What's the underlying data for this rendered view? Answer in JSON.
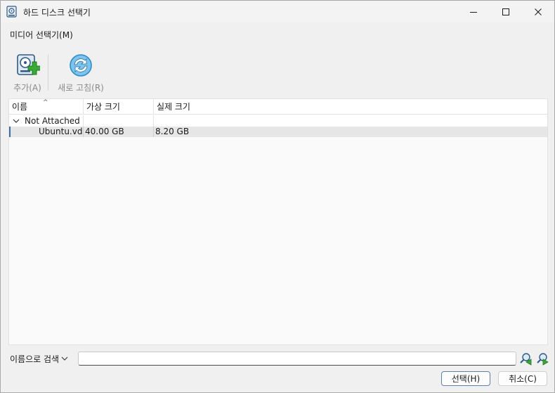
{
  "window": {
    "title": "하드 디스크 선택기"
  },
  "menu": {
    "media_label": "미디어 선택기(M)"
  },
  "toolbar": {
    "add_label": "추가(A)",
    "refresh_label": "새로 고침(R)"
  },
  "table": {
    "columns": [
      "이름",
      "가상 크기",
      "실제 크기"
    ],
    "group": {
      "label": "Not Attached"
    },
    "rows": [
      {
        "name": "Ubuntu.vdi",
        "virtual_size": "40.00 GB",
        "actual_size": "8.20 GB"
      }
    ]
  },
  "search": {
    "mode_label": "이름으로 검색",
    "value": ""
  },
  "buttons": {
    "choose_label": "선택(H)",
    "cancel_label": "취소(C)"
  },
  "colors": {
    "accent": "#3a6ea5",
    "add_icon_green": "#3aa935",
    "refresh_icon_blue": "#2e8bc9"
  }
}
